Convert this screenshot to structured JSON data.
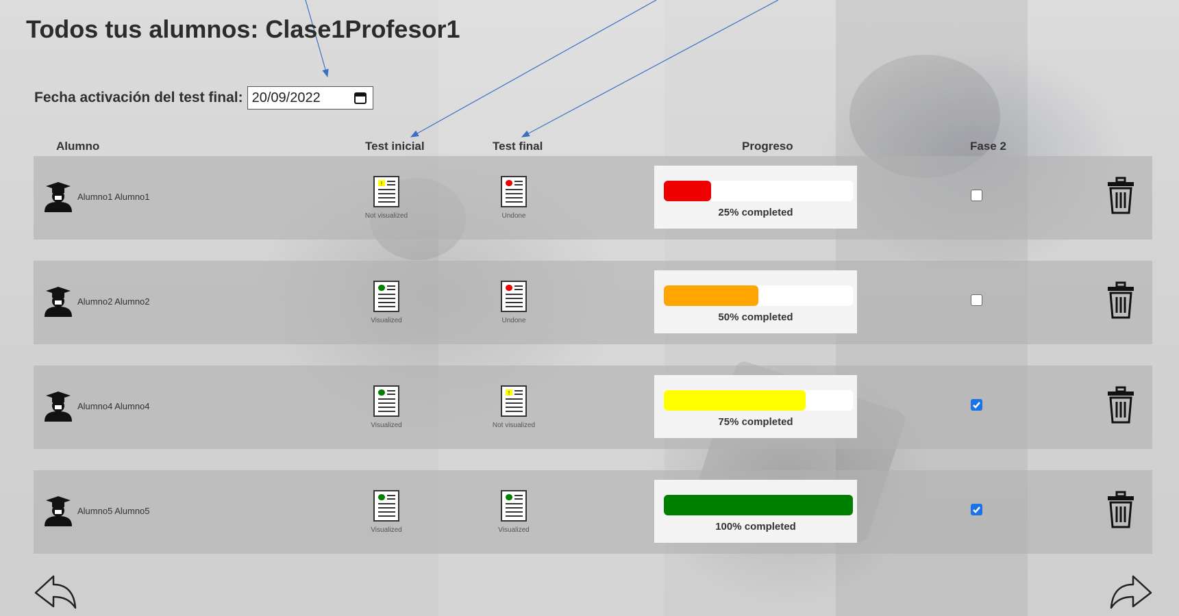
{
  "page": {
    "title": "Todos tus alumnos: Clase1Profesor1"
  },
  "activation": {
    "label": "Fecha activación del test final:",
    "date": "20/09/2022"
  },
  "columns": {
    "student": "Alumno",
    "initial": "Test inicial",
    "final": "Test final",
    "progress": "Progreso",
    "phase2": "Fase 2"
  },
  "colors": {
    "red": "#ee0000",
    "orange": "#ffa500",
    "yellow": "#ffff00",
    "green": "#008000",
    "checkbox": "#1a73e8"
  },
  "students": [
    {
      "name": "Alumno1 Alumno1",
      "initial": {
        "status": "Not visualized",
        "dot": "yellow"
      },
      "final": {
        "status": "Undone",
        "dot": "red"
      },
      "progress": 0.25,
      "progress_text": "25%  completed",
      "bar_color": "#ee0000",
      "phase2": false
    },
    {
      "name": "Alumno2 Alumno2",
      "initial": {
        "status": "Visualized",
        "dot": "green"
      },
      "final": {
        "status": "Undone",
        "dot": "red"
      },
      "progress": 0.5,
      "progress_text": "50%  completed",
      "bar_color": "#ffa500",
      "phase2": false
    },
    {
      "name": "Alumno4 Alumno4",
      "initial": {
        "status": "Visualized",
        "dot": "green"
      },
      "final": {
        "status": "Not visualized",
        "dot": "yellow"
      },
      "progress": 0.75,
      "progress_text": "75%  completed",
      "bar_color": "#ffff00",
      "phase2": true
    },
    {
      "name": "Alumno5 Alumno5",
      "initial": {
        "status": "Visualized",
        "dot": "green"
      },
      "final": {
        "status": "Visualized",
        "dot": "green"
      },
      "progress": 1.0,
      "progress_text": "100%  completed",
      "bar_color": "#008000",
      "phase2": true
    }
  ],
  "icons": {
    "student": "student-graduate-icon",
    "test": "test-document-icon",
    "delete": "trash-icon",
    "back": "back-arrow-icon",
    "forward": "forward-arrow-icon",
    "calendar": "calendar-icon"
  }
}
